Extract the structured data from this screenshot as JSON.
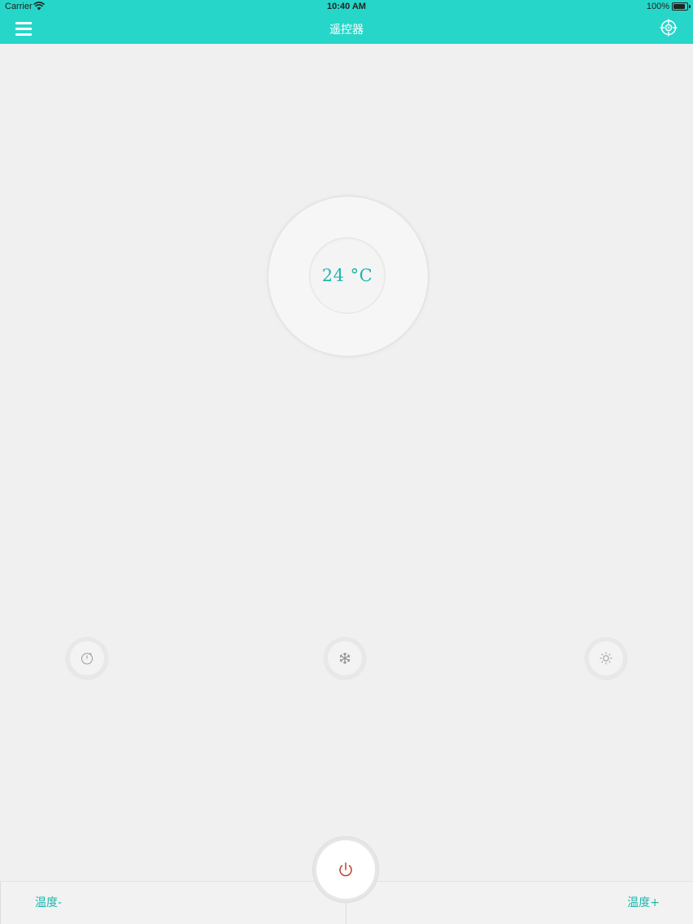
{
  "status_bar": {
    "carrier": "Carrier",
    "time": "10:40 AM",
    "battery": "100%",
    "battery_level": 1.0,
    "wifi_icon": "wifi-icon",
    "battery_icon": "battery-icon"
  },
  "nav": {
    "title": "遥控器",
    "menu_icon": "hamburger-menu-icon",
    "right_icon": "crosshair-target-icon"
  },
  "dial": {
    "temperature": "24 °C"
  },
  "mode_buttons": [
    {
      "icon": "timer-icon"
    },
    {
      "icon": "snowflake-icon"
    },
    {
      "icon": "sun-icon"
    }
  ],
  "bottom": {
    "temp_down_label": "温度-",
    "temp_up_label": "温度+",
    "power_icon": "power-icon"
  },
  "colors": {
    "accent": "#26d6c9",
    "accent_text": "#1fb7ad",
    "background": "#f1f0f1",
    "power": "#c0392b"
  }
}
